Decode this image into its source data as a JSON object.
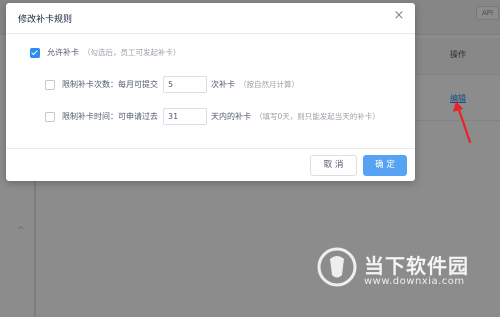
{
  "background": {
    "api_badge": "API",
    "table_header": "操作",
    "edit_link": "编辑",
    "sidebar_caret": "^"
  },
  "dialog": {
    "title": "修改补卡规则",
    "close_icon": "×",
    "allow_makeup": {
      "checked": true,
      "label": "允许补卡",
      "hint": "（勾选后，员工可发起补卡）"
    },
    "limit_count": {
      "checked": false,
      "label_before": "限制补卡次数：每月可提交",
      "value": "5",
      "label_after": "次补卡",
      "hint": "（按自然月计算）"
    },
    "limit_time": {
      "checked": false,
      "label_before": "限制补卡时间：可申请过去",
      "value": "31",
      "label_after": "天内的补卡",
      "hint": "（填写0天，则只能发起当天的补卡）"
    },
    "cancel_label": "取 消",
    "ok_label": "确 定"
  },
  "watermark": {
    "text": "当下软件园",
    "url": "www.downxia.com"
  },
  "colors": {
    "primary": "#57a3f3",
    "checkbox_checked": "#2d8cf0",
    "annotation_arrow": "#e8232a"
  }
}
